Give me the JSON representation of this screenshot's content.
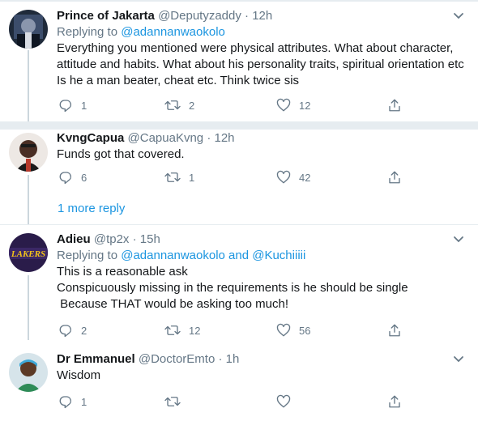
{
  "tweets": [
    {
      "name": "Prince of Jakarta",
      "handle": "@Deputyzaddy",
      "dot": "·",
      "time": "12h",
      "replying_prefix": "Replying to ",
      "replying_to": "@adannanwaokolo",
      "text": "Everything you mentioned were physical attributes. What about character,\nattitude and habits. What about his personality traits, spiritual orientation etc\nIs he a man beater, cheat etc. Think twice sis",
      "reply_count": "1",
      "retweet_count": "2",
      "like_count": "12"
    },
    {
      "name": "KvngCapua",
      "handle": "@CapuaKvng",
      "dot": "·",
      "time": "12h",
      "text": "Funds got that covered.",
      "reply_count": "6",
      "retweet_count": "1",
      "like_count": "42"
    },
    {
      "name": "Adieu",
      "handle": "@tp2x",
      "dot": "·",
      "time": "15h",
      "replying_prefix": "Replying to ",
      "replying_to": "@adannanwaokolo and @Kuchiiiii",
      "text": "This is a reasonable ask\nConspicuously missing in the requirements is he should be single\n Because THAT would be asking too much!",
      "reply_count": "2",
      "retweet_count": "12",
      "like_count": "56"
    },
    {
      "name": "Dr Emmanuel",
      "handle": "@DoctorEmto",
      "dot": "·",
      "time": "1h",
      "text": "Wisdom",
      "reply_count": "1",
      "retweet_count": "",
      "like_count": ""
    }
  ],
  "more_replies_label": "1 more reply",
  "colors": {
    "link": "#1b95e0",
    "muted": "#657786",
    "separator": "#e6ecf0",
    "thread_line": "#ccd6dd"
  },
  "icons": [
    "reply-icon",
    "retweet-icon",
    "like-icon",
    "share-icon",
    "chevron-down-icon"
  ]
}
